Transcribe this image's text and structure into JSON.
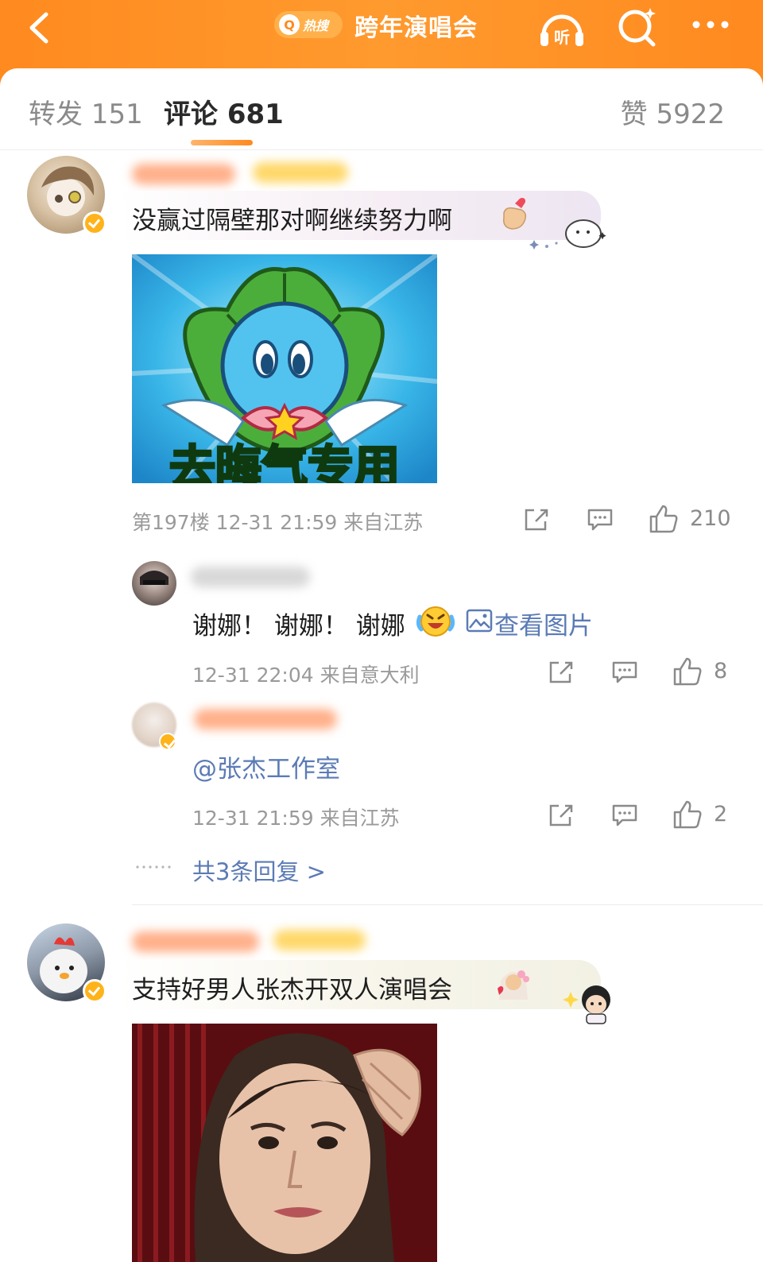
{
  "header": {
    "hot_badge_text": "热搜",
    "title": "跨年演唱会",
    "colors": {
      "bar": "#ff8a1f"
    },
    "icons": [
      "back-chevron-icon",
      "listen-icon",
      "search-icon",
      "more-icon"
    ],
    "listen_label": "听"
  },
  "tabs": {
    "repost": "转发 151",
    "comments": "评论 681",
    "likes": "赞 5922"
  },
  "comments": [
    {
      "text": "没赢过隔壁那对啊继续努力啊",
      "image_caption": "去晦气专用",
      "meta": "第197楼 12-31 21:59 来自江苏",
      "like_count": "210",
      "replies": [
        {
          "text": "谢娜！ 谢娜！ 谢娜",
          "view_image_label": "查看图片",
          "meta": "12-31 22:04 来自意大利",
          "like_count": "8"
        },
        {
          "text": "@张杰工作室",
          "meta": "12-31 21:59 来自江苏",
          "like_count": "2"
        }
      ],
      "more_replies": "共3条回复 >"
    },
    {
      "text": "支持好男人张杰开双人演唱会"
    }
  ]
}
